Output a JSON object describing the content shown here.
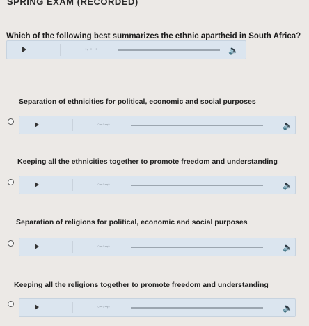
{
  "exam": {
    "title": "SPRING EXAM (RECORDED)"
  },
  "question": {
    "text": "Which of the following best summarizes the ethnic apartheid in South Africa?"
  },
  "options": [
    {
      "label": "Separation of ethnicities for political, economic and social purposes"
    },
    {
      "label": "Keeping all the ethnicities together to promote freedom and understanding"
    },
    {
      "label": "Separation of religions for political, economic and social purposes"
    },
    {
      "label": "Keeping all the religions together to promote freedom and understanding"
    }
  ],
  "audio": {
    "wave_glyph": "◦⌐◦¬◦"
  },
  "icons": {
    "play": "play-icon",
    "speaker": "speaker-icon"
  },
  "colors": {
    "background": "#ece9e6",
    "player": "#dbe5ef"
  }
}
